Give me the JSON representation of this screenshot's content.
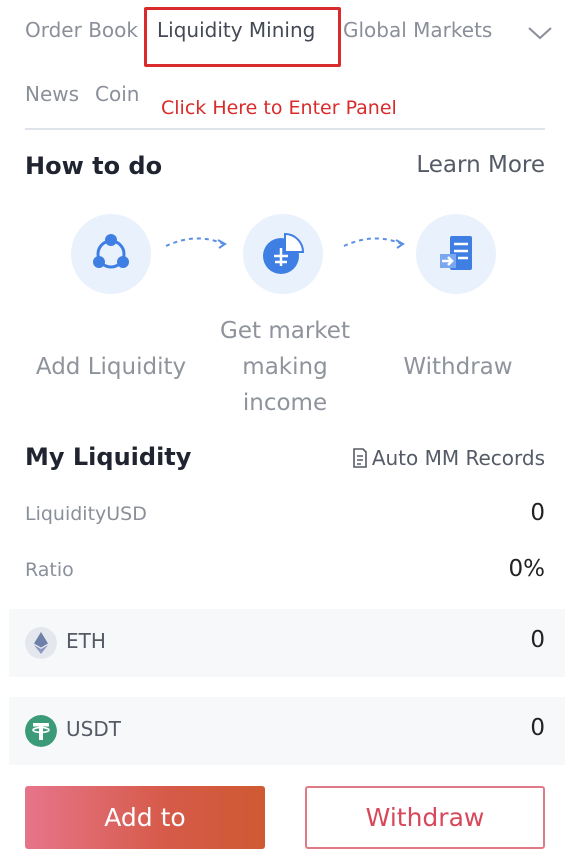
{
  "tabs": {
    "order_book": "Order Book",
    "liquidity_mining": "Liquidity Mining",
    "global_markets": "Global Markets",
    "news": "News",
    "coin": "Coin"
  },
  "annotation": "Click Here to Enter Panel",
  "how_to": {
    "title": "How to do",
    "learn_more": "Learn More",
    "steps": [
      {
        "label": "Add Liquidity",
        "icon": "share-nodes-icon"
      },
      {
        "label": "Get market making income",
        "icon": "pie-chart-icon"
      },
      {
        "label": "Withdraw",
        "icon": "withdraw-document-icon"
      }
    ]
  },
  "my_liquidity": {
    "title": "My Liquidity",
    "records": "Auto MM Records",
    "liquidity_usd_label": "LiquidityUSD",
    "liquidity_usd_value": "0",
    "ratio_label": "Ratio",
    "ratio_value": "0%"
  },
  "assets": [
    {
      "symbol": "ETH",
      "value": "0",
      "icon": "eth-icon"
    },
    {
      "symbol": "USDT",
      "value": "0",
      "icon": "usdt-icon"
    }
  ],
  "buttons": {
    "add": "Add to",
    "withdraw": "Withdraw"
  },
  "colors": {
    "accent_red": "#d92b2b",
    "icon_blue": "#3f7fe4",
    "usdt_green": "#3b9a78"
  }
}
